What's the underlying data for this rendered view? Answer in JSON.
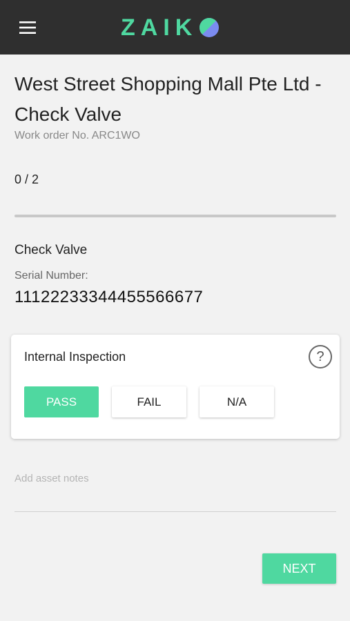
{
  "header": {
    "menu_icon": "hamburger-menu-icon",
    "logo_text": "ZAIK",
    "logo_mark_icon": "split-circle-logo-mark",
    "colors": {
      "bar": "#2f2f2f",
      "logo_green": "#4fd8a0",
      "logo_purple": "#7b8bf0"
    }
  },
  "work_order": {
    "title": "West Street Shopping Mall Pte Ltd - Check Valve",
    "number_text": "Work order No. ARC1WO"
  },
  "progress": {
    "text": "0 / 2",
    "completed": 0,
    "total": 2
  },
  "asset": {
    "name": "Check Valve",
    "serial_label": "Serial Number:",
    "serial_value": "11122233344455566677"
  },
  "inspection": {
    "title": "Internal Inspection",
    "help_icon": "question-circle-icon",
    "help_glyph": "?",
    "options": [
      {
        "label": "PASS",
        "selected": true
      },
      {
        "label": "FAIL",
        "selected": false
      },
      {
        "label": "N/A",
        "selected": false
      }
    ]
  },
  "notes": {
    "placeholder": "Add asset notes",
    "value": ""
  },
  "actions": {
    "next_label": "NEXT"
  },
  "accent_color": "#4fd8a0"
}
